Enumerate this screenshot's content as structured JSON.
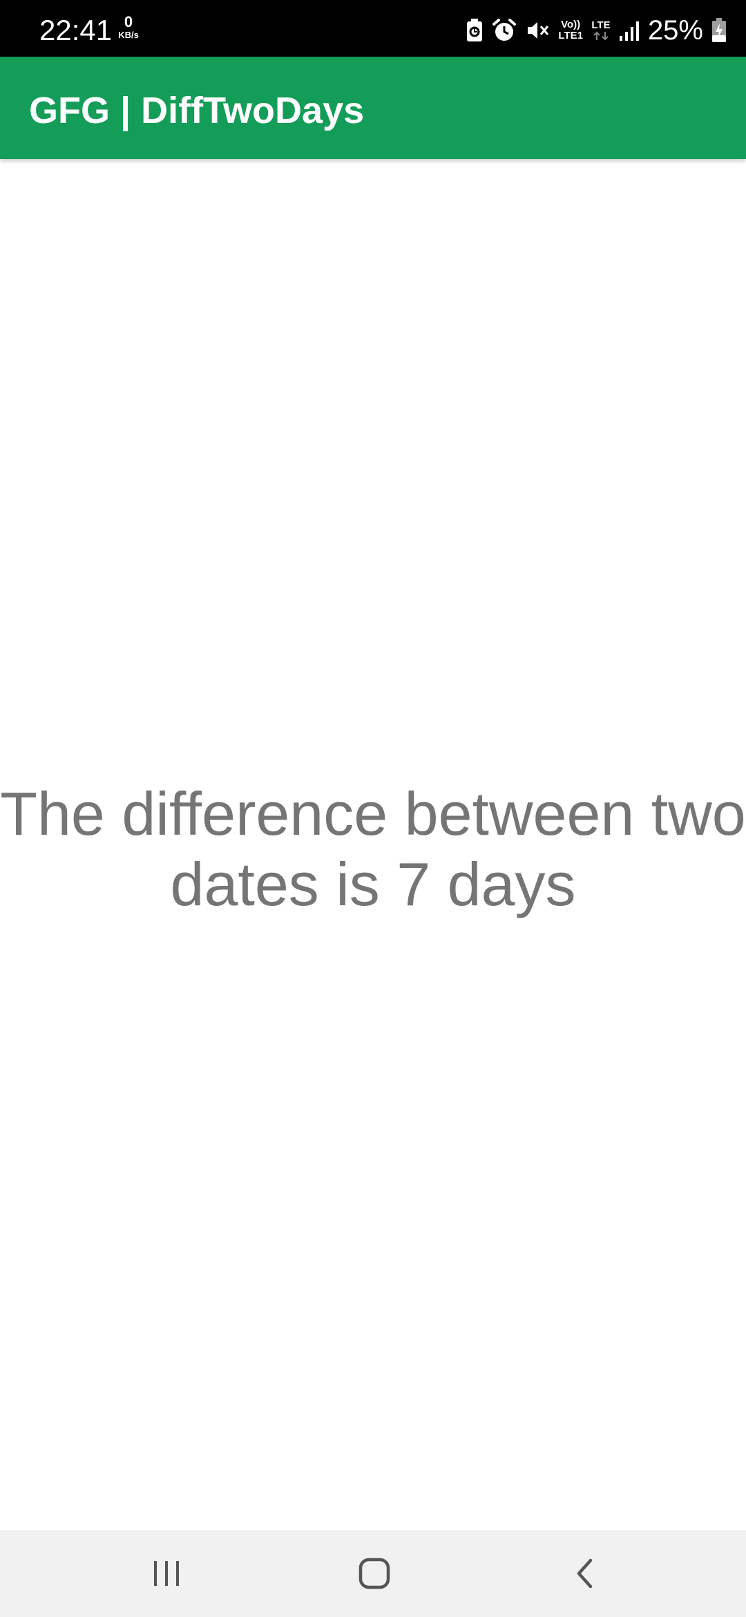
{
  "status_bar": {
    "time": "22:41",
    "net_speed_value": "0",
    "net_speed_unit": "KB/s",
    "volte_line1": "Vo))",
    "volte_line2": "LTE1",
    "lte_label": "LTE",
    "battery_percent": "25%",
    "icons": [
      "data-saver-icon",
      "alarm-icon",
      "mute-icon",
      "volte-icon",
      "lte-data-icon",
      "signal-icon",
      "battery-charging-icon"
    ]
  },
  "app_bar": {
    "title": "GFG | DiffTwoDays",
    "background_color": "#139d58"
  },
  "content": {
    "result_line1": "The difference between two",
    "result_line2": "dates is 7 days",
    "text_color": "#757575"
  },
  "nav_bar": {
    "buttons": [
      "recent-apps-icon",
      "home-icon",
      "back-icon"
    ]
  }
}
